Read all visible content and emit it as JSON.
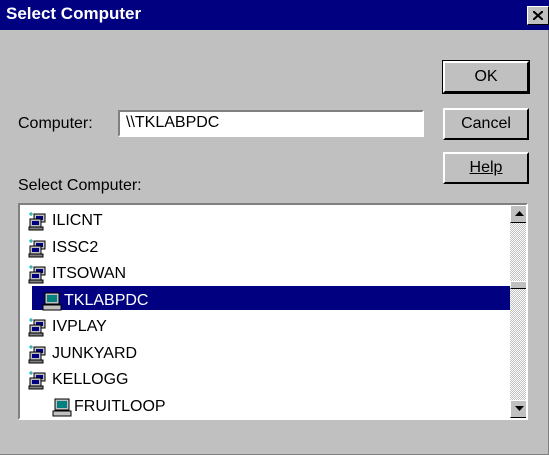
{
  "dialog": {
    "title": "Select Computer",
    "close_glyph": "✕"
  },
  "buttons": {
    "ok": "OK",
    "cancel": "Cancel",
    "help": "Help"
  },
  "computer_field": {
    "label": "Computer:",
    "value": "\\\\TKLABPDC"
  },
  "list": {
    "label": "Select Computer:",
    "items": [
      {
        "label": "ILICNT",
        "icon": "domain-icon",
        "selected": false
      },
      {
        "label": "ISSC2",
        "icon": "domain-icon",
        "selected": false
      },
      {
        "label": "ITSOWAN",
        "icon": "domain-icon",
        "selected": false
      },
      {
        "label": "TKLABPDC",
        "icon": "computer-icon",
        "selected": true
      },
      {
        "label": "IVPLAY",
        "icon": "domain-icon",
        "selected": false
      },
      {
        "label": "JUNKYARD",
        "icon": "domain-icon",
        "selected": false
      },
      {
        "label": "KELLOGG",
        "icon": "domain-icon",
        "selected": false
      },
      {
        "label": "FRUITLOOP",
        "icon": "computer-icon",
        "selected": false
      }
    ]
  },
  "colors": {
    "titlebar": "#000080",
    "face": "#c0c0c0",
    "selection": "#000080"
  }
}
